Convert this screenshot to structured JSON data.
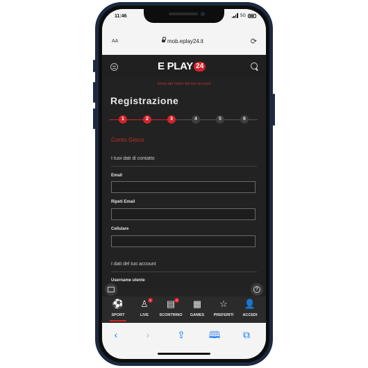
{
  "status_bar": {
    "time": "11:46",
    "network": "5G"
  },
  "browser": {
    "text_size_label": "AA",
    "url": "mob.eplay24.it",
    "reload_icon": "reload-icon"
  },
  "header": {
    "logo_text": "E PLAY",
    "logo_badge": "24",
    "menu_icon": "menu-icon",
    "search_icon": "search-icon"
  },
  "page": {
    "back_link": "torna alla home del tuo account",
    "title": "Registrazione",
    "steps": [
      {
        "label": "1",
        "active": true
      },
      {
        "label": "2",
        "active": true
      },
      {
        "label": "3",
        "active": true
      },
      {
        "label": "4",
        "active": false
      },
      {
        "label": "5",
        "active": false
      },
      {
        "label": "6",
        "active": false
      }
    ],
    "section_title": "Conto Gioco",
    "contact_heading": "I tuoi dati di contatto",
    "fields": [
      {
        "label": "Email",
        "value": ""
      },
      {
        "label": "Ripeti Email",
        "value": ""
      },
      {
        "label": "Cellulare",
        "value": ""
      }
    ],
    "account_heading": "I dati del tuo account",
    "partial_label": "Username utente"
  },
  "bottom_nav": [
    {
      "label": "SPORT",
      "icon": "soccer-ball-icon",
      "active": true,
      "badge": ""
    },
    {
      "label": "LIVE",
      "icon": "live-player-icon",
      "active": false,
      "badge": "9"
    },
    {
      "label": "SCONTRINO",
      "icon": "ticket-icon",
      "active": false,
      "badge": "0"
    },
    {
      "label": "GAMES",
      "icon": "slot-machine-icon",
      "active": false,
      "badge": ""
    },
    {
      "label": "PREFERITI",
      "icon": "star-icon",
      "active": false,
      "badge": ""
    },
    {
      "label": "ACCEDI",
      "icon": "user-icon",
      "active": false,
      "badge": ""
    }
  ],
  "safari_toolbar": [
    "back-icon",
    "forward-icon",
    "share-icon",
    "bookmarks-icon",
    "tabs-icon"
  ],
  "colors": {
    "accent": "#d2232a",
    "background": "#222222",
    "header": "#202020"
  }
}
